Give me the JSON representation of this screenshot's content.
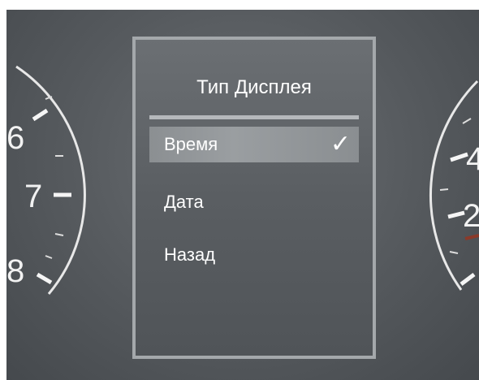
{
  "display_menu": {
    "title": "Тип Дисплея",
    "items": [
      {
        "label": "Время",
        "selected": true,
        "check_icon": "checkmark-icon"
      },
      {
        "label": "Дата",
        "selected": false
      },
      {
        "label": "Назад",
        "selected": false
      }
    ]
  },
  "left_gauge": {
    "labels": [
      "6",
      "7",
      "8"
    ]
  },
  "right_gauge": {
    "labels": [
      "4",
      "2"
    ]
  },
  "colors": {
    "panel_border": "#a4a8ab",
    "selected_row": "#9a9ea1",
    "background": "#55595d"
  }
}
